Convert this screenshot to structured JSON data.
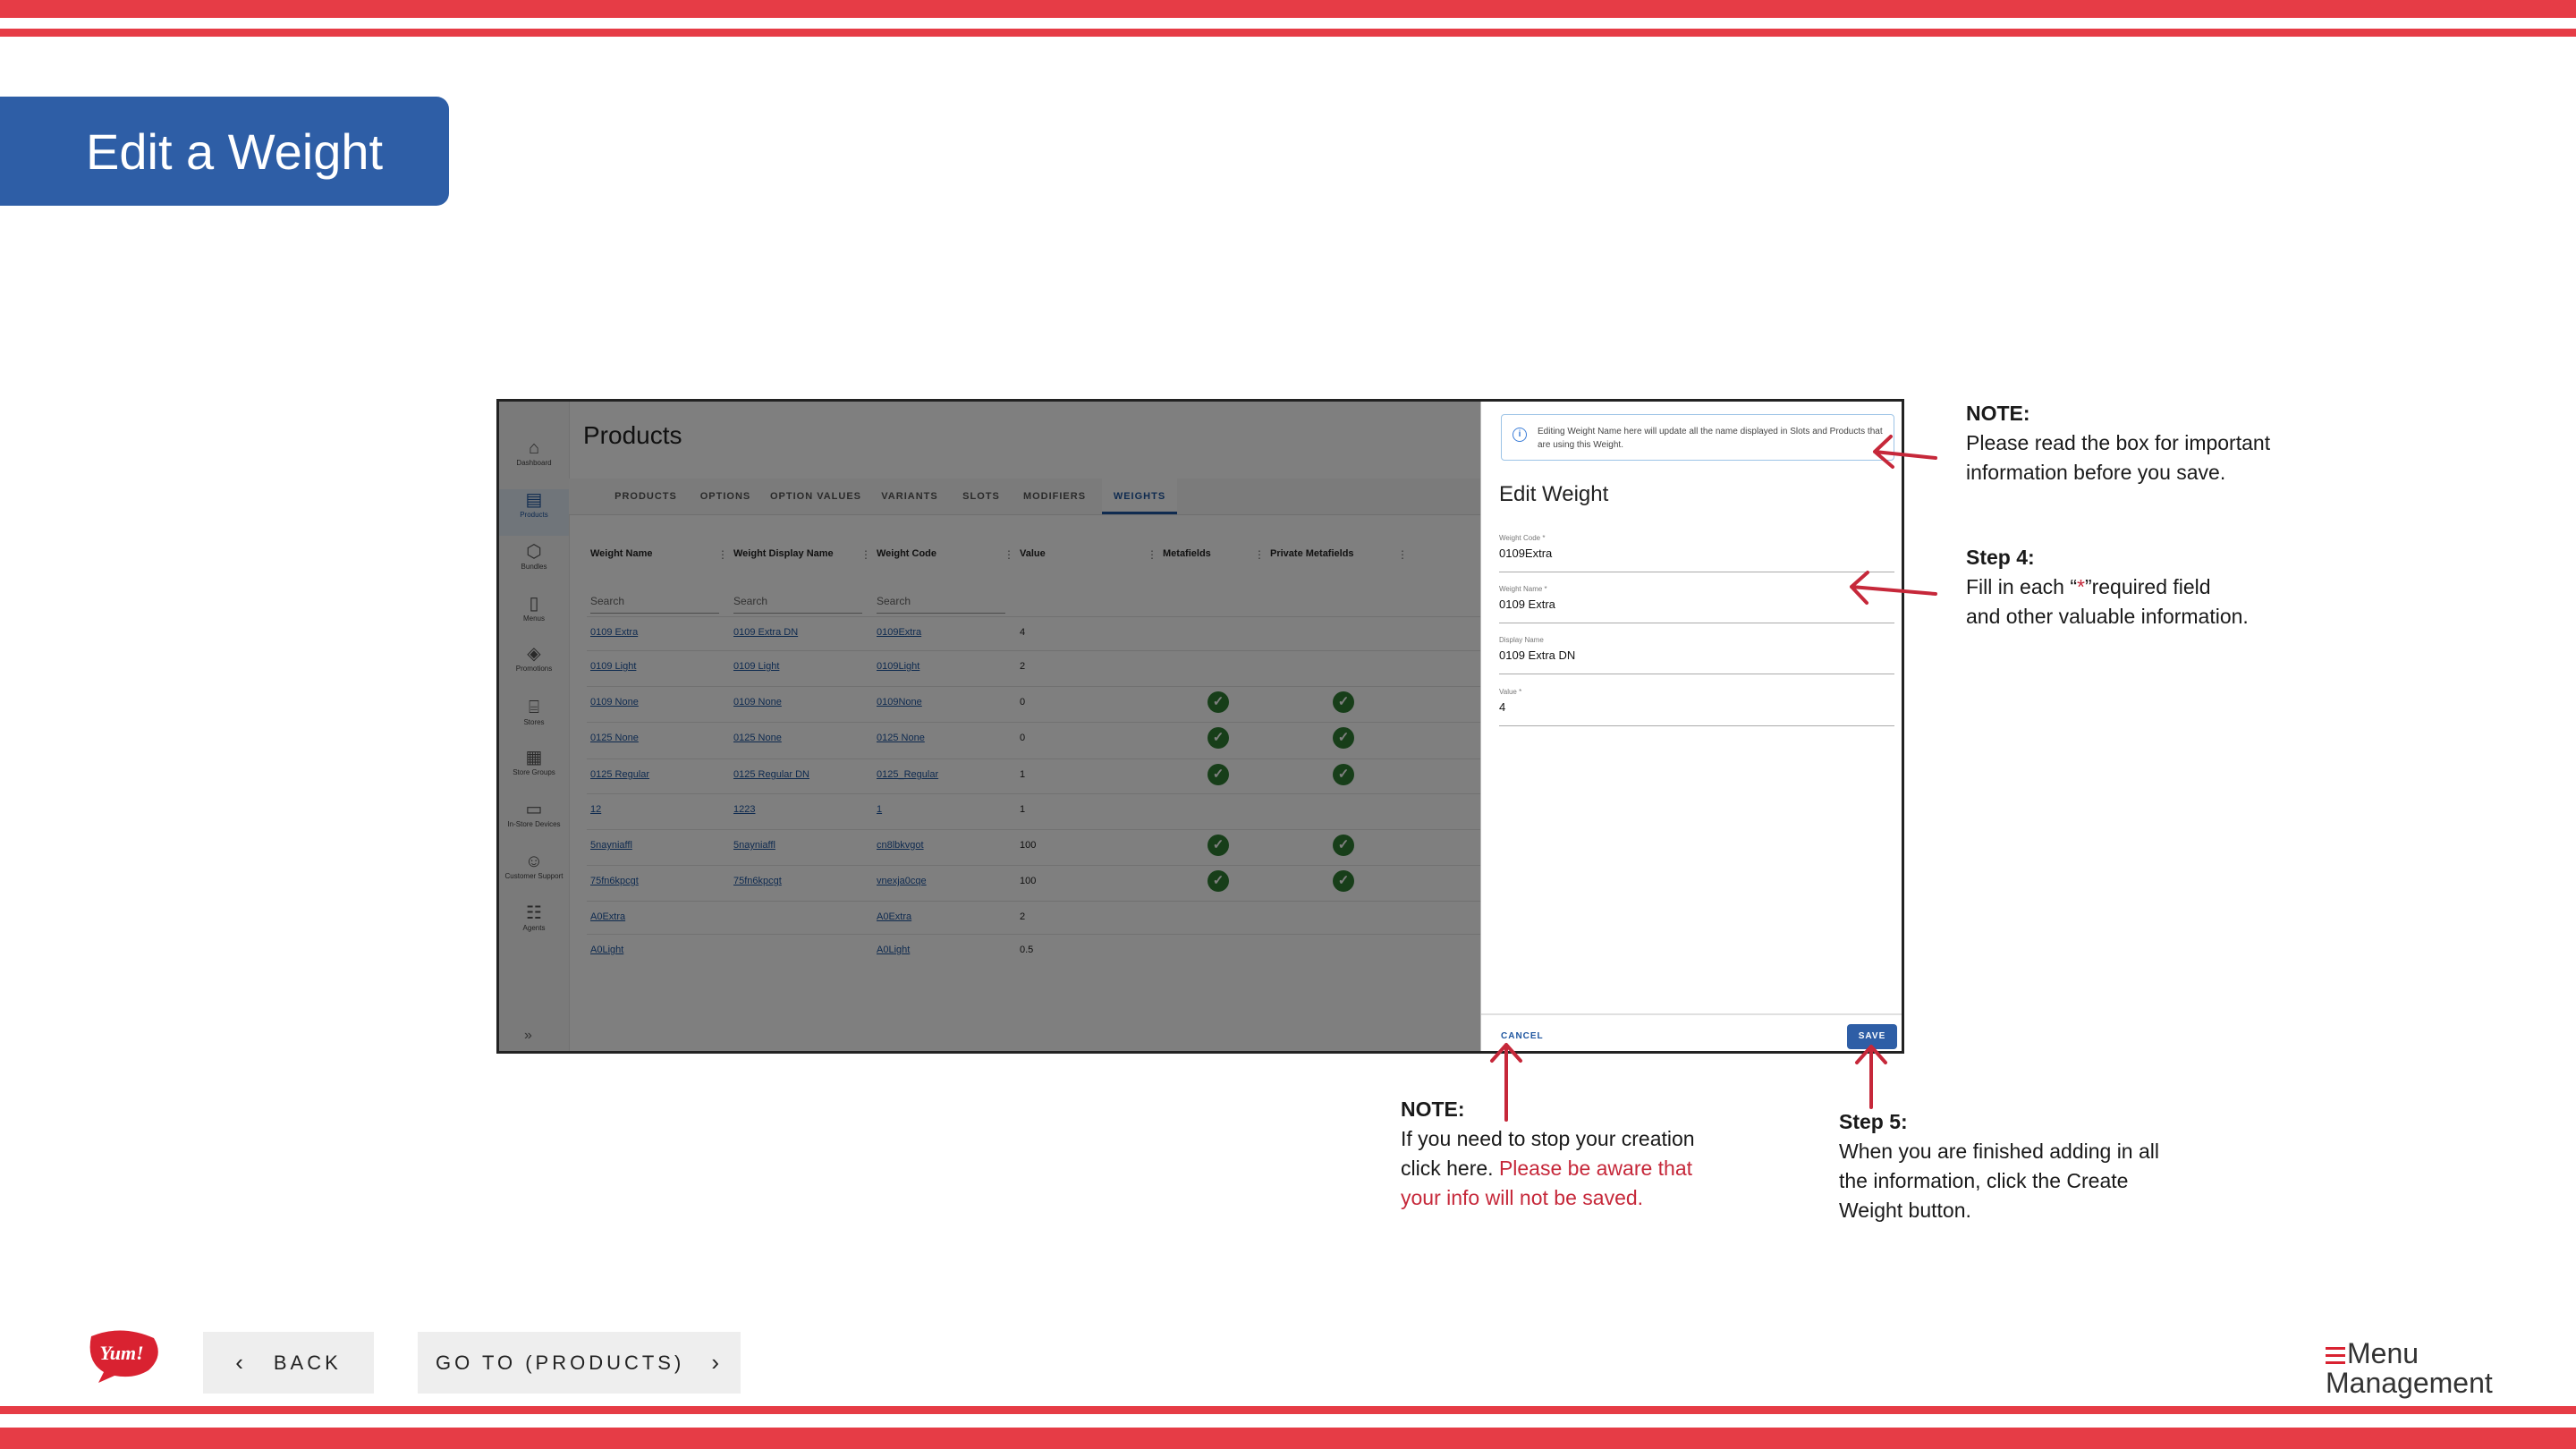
{
  "slide": {
    "title": "Edit a Weight",
    "colors": {
      "stripe": "#e63c46",
      "title_bg": "#2e5ea6",
      "accent_red": "#c6283a",
      "primary_blue": "#1f56a0"
    }
  },
  "app": {
    "page_title": "Products",
    "sidebar": [
      {
        "label": "Dashboard",
        "icon": "home-icon",
        "glyph": "⌂"
      },
      {
        "label": "Products",
        "icon": "box-icon",
        "glyph": "▤",
        "active": true
      },
      {
        "label": "Bundles",
        "icon": "cube-icon",
        "glyph": "⬡"
      },
      {
        "label": "Menus",
        "icon": "document-icon",
        "glyph": "▯"
      },
      {
        "label": "Promotions",
        "icon": "tag-icon",
        "glyph": "◈"
      },
      {
        "label": "Stores",
        "icon": "store-icon",
        "glyph": "⌸"
      },
      {
        "label": "Store Groups",
        "icon": "grid-icon",
        "glyph": "▦"
      },
      {
        "label": "In-Store Devices",
        "icon": "monitor-icon",
        "glyph": "▭"
      },
      {
        "label": "Customer Support",
        "icon": "support-icon",
        "glyph": "☺"
      },
      {
        "label": "Agents",
        "icon": "people-icon",
        "glyph": "☷"
      }
    ],
    "expand_icon": "»",
    "tabs": [
      "PRODUCTS",
      "OPTIONS",
      "OPTION VALUES",
      "VARIANTS",
      "SLOTS",
      "MODIFIERS",
      "WEIGHTS"
    ],
    "active_tab": "WEIGHTS",
    "table": {
      "columns": [
        "Weight Name",
        "Weight Display Name",
        "Weight Code",
        "Value",
        "Metafields",
        "Private Metafields"
      ],
      "search_placeholder": "Search",
      "rows": [
        {
          "name": "0109 Extra",
          "display": "0109 Extra DN",
          "code": "0109Extra",
          "value": "4",
          "meta": false,
          "private": false
        },
        {
          "name": "0109 Light",
          "display": "0109 Light",
          "code": "0109Light",
          "value": "2",
          "meta": false,
          "private": false
        },
        {
          "name": "0109 None",
          "display": "0109 None",
          "code": "0109None",
          "value": "0",
          "meta": true,
          "private": true
        },
        {
          "name": "0125 None",
          "display": "0125 None",
          "code": "0125 None",
          "value": "0",
          "meta": true,
          "private": true
        },
        {
          "name": "0125 Regular",
          "display": "0125 Regular DN",
          "code": "0125_Regular",
          "value": "1",
          "meta": true,
          "private": true
        },
        {
          "name": "12",
          "display": "1223",
          "code": "1",
          "value": "1",
          "meta": false,
          "private": false
        },
        {
          "name": "5nayniaffl",
          "display": "5nayniaffl",
          "code": "cn8lbkvgot",
          "value": "100",
          "meta": true,
          "private": true
        },
        {
          "name": "75fn6kpcgt",
          "display": "75fn6kpcgt",
          "code": "vnexja0cqe",
          "value": "100",
          "meta": true,
          "private": true
        },
        {
          "name": "A0Extra",
          "display": "",
          "code": "A0Extra",
          "value": "2",
          "meta": false,
          "private": false
        },
        {
          "name": "A0Light",
          "display": "",
          "code": "A0Light",
          "value": "0.5",
          "meta": false,
          "private": false
        }
      ]
    }
  },
  "panel": {
    "info_text": "Editing Weight Name here will update all the name displayed in Slots and Products that are using this Weight.",
    "title": "Edit Weight",
    "fields": [
      {
        "label": "Weight Code *",
        "value": "0109Extra"
      },
      {
        "label": "Weight Name *",
        "value": "0109 Extra"
      },
      {
        "label": "Display Name",
        "value": "0109 Extra DN"
      },
      {
        "label": "Value *",
        "value": "4"
      }
    ],
    "cancel_label": "CANCEL",
    "save_label": "SAVE"
  },
  "annotations": {
    "note1_head": "NOTE:",
    "note1_line1": "Please read the box for important",
    "note1_line2": "information before you save.",
    "step4_head": "Step 4:",
    "step4_pre": "Fill in each “",
    "step4_star": "*",
    "step4_post": "”required field",
    "step4_line2": "and other valuable information.",
    "note2_head": "NOTE:",
    "note2_line1": "If you need to stop your creation",
    "note2_line2a": "click here. ",
    "note2_line2b": "Please be aware that",
    "note2_line3": "your info will not be saved.",
    "step5_head": "Step 5:",
    "step5_line1": "When you are finished adding in all",
    "step5_line2": "the information, click the Create",
    "step5_line3": "Weight button."
  },
  "footer": {
    "back_label": "BACK",
    "goto_label": "GO TO (PRODUCTS)",
    "yum_logo": "Yum!",
    "brand_line1": "Menu",
    "brand_line2": "Management"
  }
}
